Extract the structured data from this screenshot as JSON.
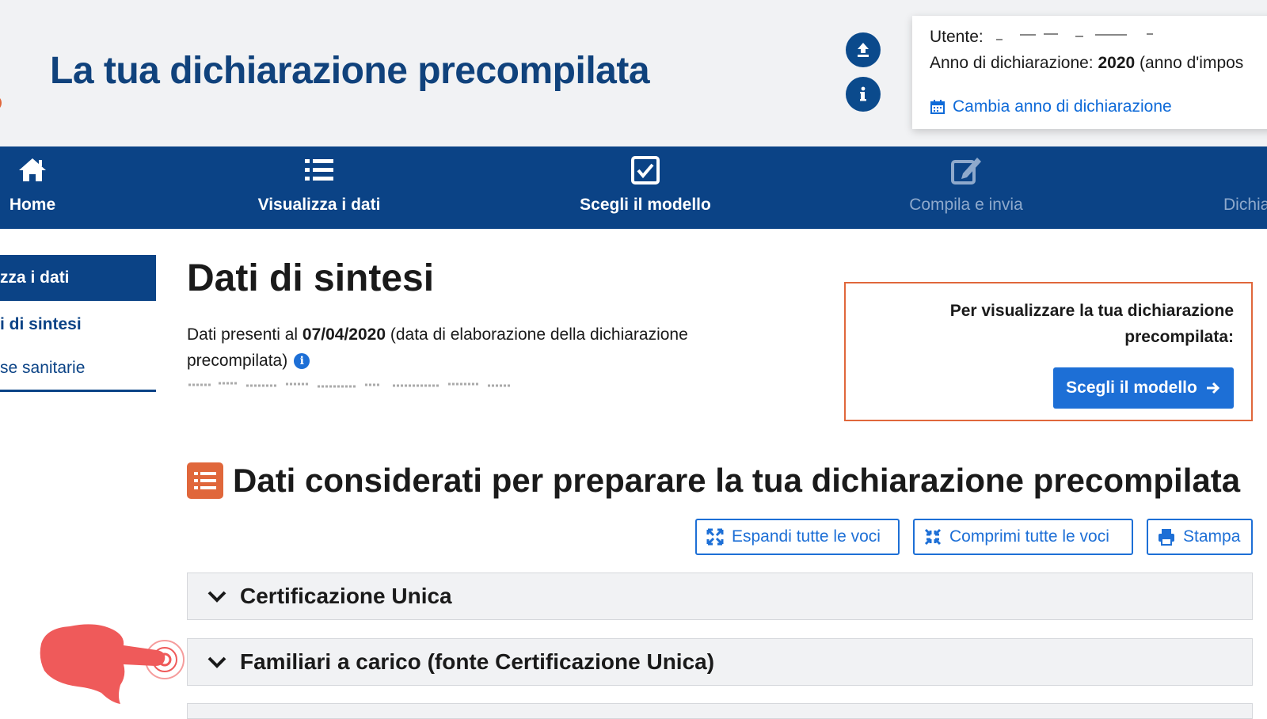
{
  "header": {
    "title": "La tua dichiarazione precompilata",
    "user_label": "Utente:",
    "year_label": "Anno di dichiarazione:",
    "year_value": "2020",
    "year_suffix": "(anno d'impos",
    "change_year": "Cambia anno di dichiarazione"
  },
  "nav": {
    "items": [
      {
        "label": "Home",
        "icon": "home-icon"
      },
      {
        "label": "Visualizza i dati",
        "icon": "list-icon"
      },
      {
        "label": "Scegli il modello",
        "icon": "checkbox-icon"
      },
      {
        "label": "Compila e invia",
        "icon": "edit-icon"
      },
      {
        "label": "Dichia",
        "icon": ""
      }
    ]
  },
  "sidebar": {
    "items": [
      {
        "label": "zza i dati"
      },
      {
        "label": "i di sintesi"
      },
      {
        "label": "se sanitarie"
      }
    ]
  },
  "main": {
    "title": "Dati di sintesi",
    "intro_prefix": "Dati presenti al",
    "intro_date": "07/04/2020",
    "intro_suffix": "(data di elaborazione della dichiarazione precompilata)",
    "promo_text": "Per visualizzare la tua dichiarazione precompilata:",
    "promo_button": "Scegli il modello",
    "section_title": "Dati considerati per preparare la tua dichiarazione precompilata",
    "toolbar": {
      "expand": "Espandi tutte le voci",
      "collapse": "Comprimi tutte le voci",
      "print": "Stampa"
    },
    "accordions": [
      {
        "label": "Certificazione Unica"
      },
      {
        "label": "Familiari a carico (fonte Certificazione Unica)"
      }
    ]
  },
  "colors": {
    "brand_blue": "#0b4386",
    "accent_blue": "#1d6fd6",
    "accent_orange": "#e0673b",
    "pointer_red": "#ef5a5a"
  }
}
